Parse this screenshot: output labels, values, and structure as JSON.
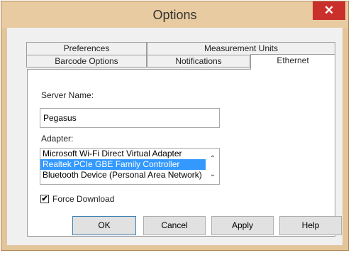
{
  "window": {
    "title": "Options",
    "close_symbol": "✕"
  },
  "tabs": {
    "row_back": [
      {
        "label": "Preferences"
      },
      {
        "label": "Measurement Units"
      }
    ],
    "row_front": [
      {
        "label": "Barcode Options"
      },
      {
        "label": "Notifications"
      },
      {
        "label": "Ethernet",
        "selected": true
      }
    ]
  },
  "ethernet": {
    "server_name_label": "Server Name:",
    "server_name_value": "Pegasus",
    "adapter_label": "Adapter:",
    "adapters": [
      {
        "label": "Microsoft Wi-Fi Direct Virtual Adapter",
        "selected": false
      },
      {
        "label": "Realtek PCIe GBE Family Controller",
        "selected": true
      },
      {
        "label": "Bluetooth Device (Personal Area Network)",
        "selected": false
      }
    ],
    "scroll_up_symbol": "⌃",
    "scroll_down_symbol": "⌄",
    "force_download_label": "Force Download",
    "force_download_checked": true,
    "check_symbol": "✔"
  },
  "buttons": {
    "ok": "OK",
    "cancel": "Cancel",
    "apply": "Apply",
    "help": "Help"
  },
  "colors": {
    "titlebar": "#e8cba0",
    "close": "#c9302b",
    "selection": "#3399ff"
  }
}
